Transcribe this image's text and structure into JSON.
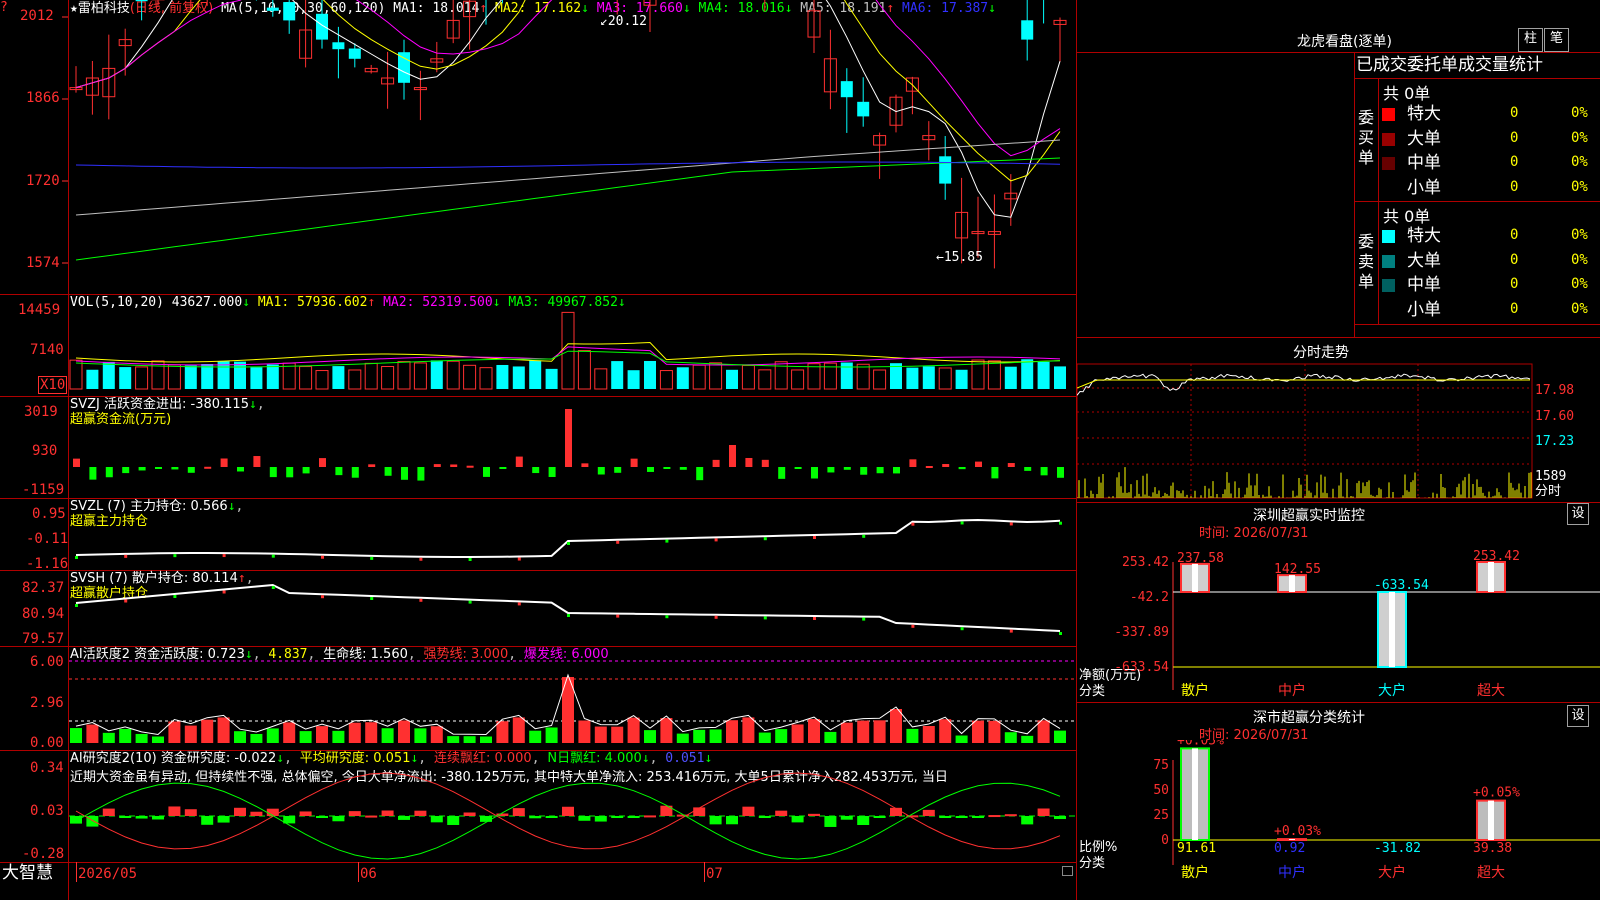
{
  "main": {
    "menu_icon": "?",
    "stock_prefix": "★",
    "stock_name": "雷柏科技",
    "period": "(日线, 前复权)",
    "ma_params": "MA(5,10,20,30,60,120)",
    "ma": [
      {
        "label": "MA1: 18.014",
        "arrow": "↑",
        "color": "#ffffff"
      },
      {
        "label": "MA2: 17.162",
        "arrow": "↓",
        "color": "#ffff00"
      },
      {
        "label": "MA3: 17.660",
        "arrow": "↓",
        "color": "#ff00ff"
      },
      {
        "label": "MA4: 18.016",
        "arrow": "↓",
        "color": "#00ff00"
      },
      {
        "label": "MA5: 18.191",
        "arrow": "↑",
        "color": "#c0c0c0"
      },
      {
        "label": "MA6: 17.387",
        "arrow": "↓",
        "color": "#3030ff"
      }
    ],
    "y_ticks": [
      "2012",
      "1866",
      "1720",
      "1574"
    ],
    "high_label": "20.12",
    "low_label": "15.85",
    "colors": {
      "up": "#ff3030",
      "down": "#00ffff",
      "grid": "#b00000",
      "axis_text": "#ff3030"
    }
  },
  "vol": {
    "title": "VOL(5,10,20)",
    "value": "43627.000",
    "value_arrow": "↓",
    "ma": [
      {
        "label": "MA1: 57936.602",
        "arrow": "↑",
        "color": "#ffff00"
      },
      {
        "label": "MA2: 52319.500",
        "arrow": "↓",
        "color": "#ff00ff"
      },
      {
        "label": "MA3: 49967.852",
        "arrow": "↓",
        "color": "#00ff00"
      }
    ],
    "y_ticks": [
      "14459",
      "7140"
    ],
    "unit": "X10"
  },
  "svzj": {
    "title": "SVZJ  活跃资金进出: -380.115",
    "arrow": "↓",
    "sub": "超赢资金流(万元)",
    "y_ticks": [
      "3019",
      "930",
      "-1159"
    ]
  },
  "svzl": {
    "title": "SVZL (7) 主力持仓: 0.566",
    "arrow": "↓",
    "sub": "超赢主力持仓",
    "y_ticks": [
      "0.95",
      "-0.11",
      "-1.16"
    ]
  },
  "svsh": {
    "title": "SVSH (7) 散户持仓: 80.114",
    "arrow": "↑",
    "sub": "超赢散户持仓",
    "y_ticks": [
      "82.37",
      "80.94",
      "79.57"
    ]
  },
  "ai_active": {
    "title": "AI活跃度2 资金活跃度: 0.723",
    "a1": "↓",
    "v2": "4.837",
    "life": "生命线: 1.560",
    "strong": "强势线: 3.000",
    "burst": "爆发线: 6.000",
    "y_ticks": [
      "6.00",
      "2.96",
      "0.00"
    ]
  },
  "ai_research": {
    "title": "AI研究度2(10) 资金研究度: -0.022",
    "avg": "平均研究度: 0.051",
    "streak": "连续飘红: 0.000",
    "ndays": "N日飘红: 4.000",
    "last": "0.051",
    "commentary": "近期大资金虽有异动, 但持续性不强, 总体偏空, 今日大单净流出: -380.125万元, 其中特大单净流入: 253.416万元, 大单5日累计净入282.453万元, 当日",
    "y_ticks": [
      "0.34",
      "0.03",
      "-0.28"
    ]
  },
  "x_axis": {
    "brand": "大智慧",
    "labels": [
      "2026/05",
      "06",
      "07"
    ]
  },
  "dragon": {
    "title": "龙虎看盘(逐单)",
    "btn_bar": "柱",
    "btn_pen": "笔",
    "header": "已成交委托单成交量统计",
    "buy": {
      "side_label": "委买单",
      "total": "共 0单",
      "rows": [
        {
          "label": "特大",
          "count": "0",
          "pct": "0%",
          "color": "#ff0000"
        },
        {
          "label": "大单",
          "count": "0",
          "pct": "0%",
          "color": "#990000"
        },
        {
          "label": "中单",
          "count": "0",
          "pct": "0%",
          "color": "#660000"
        },
        {
          "label": "小单",
          "count": "0",
          "pct": "0%",
          "color": "#000000"
        }
      ]
    },
    "sell": {
      "side_label": "委卖单",
      "total": "共 0单",
      "rows": [
        {
          "label": "特大",
          "count": "0",
          "pct": "0%",
          "color": "#00ffff"
        },
        {
          "label": "大单",
          "count": "0",
          "pct": "0%",
          "color": "#008080"
        },
        {
          "label": "中单",
          "count": "0",
          "pct": "0%",
          "color": "#006060"
        },
        {
          "label": "小单",
          "count": "0",
          "pct": "0%",
          "color": "#000000"
        }
      ]
    }
  },
  "intraday": {
    "title": "分时走势",
    "y_ticks": [
      "17.98",
      "17.60",
      "17.23"
    ],
    "vol_tick": "1589",
    "unit": "分时"
  },
  "sz_monitor": {
    "title": "深圳超赢实时监控",
    "btn_set": "设",
    "time": "时间: 2026/07/31",
    "y_ticks": [
      "253.42",
      "-42.2",
      "-337.89",
      "-633.54"
    ],
    "y_title": "净额(万元)",
    "x_title": "分类",
    "chart_data": {
      "type": "bar",
      "categories": [
        "散户",
        "中户",
        "大户",
        "超大"
      ],
      "values": [
        237.58,
        142.55,
        -633.54,
        253.42
      ],
      "labels": [
        "237.58",
        "142.55",
        "-633.54",
        "253.42"
      ],
      "ylim": [
        -633.54,
        253.42
      ]
    }
  },
  "sz_class": {
    "title": "深市超赢分类统计",
    "btn_set": "设",
    "time": "时间: 2026/07/31",
    "y_ticks": [
      "75",
      "50",
      "25",
      "0"
    ],
    "y_title": "比例%",
    "x_title": "分类",
    "chart_data": {
      "type": "bar",
      "categories": [
        "散户",
        "中户",
        "大户",
        "超大"
      ],
      "values": [
        91.61,
        0.92,
        -31.82,
        39.38
      ],
      "top_labels": [
        "+0.05%",
        "+0.03%",
        "",
        "+0.05%"
      ],
      "bottom_labels": [
        "91.61",
        "0.92",
        "-31.82",
        "39.38"
      ],
      "ylim": [
        0,
        90
      ]
    }
  }
}
